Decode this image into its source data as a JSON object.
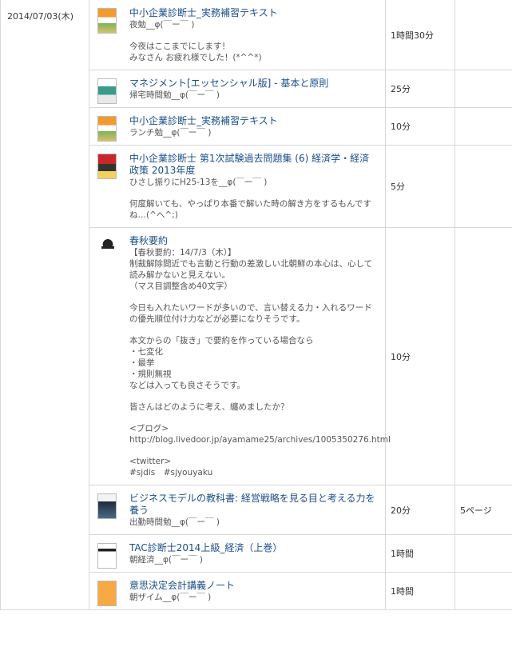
{
  "date": "2014/07/03(木)",
  "entries": [
    {
      "title": "中小企業診断士_実務補習テキスト",
      "subtitle": "夜勉__φ(￣ー￣ )",
      "comments": [
        "今夜はここまでにします！\nみなさん お疲れ様でした！(*^^*)"
      ],
      "time": "1時間30分",
      "pages": "",
      "thumb": "orange"
    },
    {
      "title": "マネジメント[エッセンシャル版] - 基本と原則",
      "subtitle": "帰宅時間勉__φ(￣ー￣ )",
      "comments": [],
      "time": "25分",
      "pages": "",
      "thumb": "teal"
    },
    {
      "title": "中小企業診断士_実務補習テキスト",
      "subtitle": "ランチ勉__φ(￣ー￣ )",
      "comments": [],
      "time": "10分",
      "pages": "",
      "thumb": "orange"
    },
    {
      "title": "中小企業診断士 第1次試験過去問題集 (6) 経済学・経済政策 2013年度",
      "subtitle": "ひさし振りにH25-13を__φ(￣ー￣ )",
      "comments": [
        "何度解いても、やっぱり本番で解いた時の解き方をするもんですね…(^へ^;)"
      ],
      "time": "5分",
      "pages": "",
      "thumb": "red"
    },
    {
      "title": "春秋要約",
      "subtitle": "【春秋要約：14/7/3（木）】",
      "comments": [
        "制裁解除間近でも言動と行動の差激しい北朝鮮の本心は、心して読み解かないと見えない。\n（マス目調整含め40文字）",
        "今日も入れたいワードが多いので、言い替える力・入れるワードの優先順位付け力などが必要になりそうです。",
        "本文からの「抜き」で要約を作っている場合なら\n・七変化\n・最挙\n・規則無視\nなどは入っても良さそうです。",
        "皆さんはどのように考え、纏めましたか？",
        "<ブログ>\nhttp://blog.livedoor.jp/ayamame25/archives/1005350276.html",
        "<twitter>\n#sjdis　#sjyouyaku"
      ],
      "time": "10分",
      "pages": "",
      "thumb": "logo"
    },
    {
      "title": "ビジネスモデルの教科書: 経営戦略を見る目と考える力を養う",
      "subtitle": "出勤時間勉__φ(￣ー￣ )",
      "comments": [],
      "time": "20分",
      "pages": "5ページ",
      "thumb": "dark"
    },
    {
      "title": "TAC診断士2014上級_経済（上巻）",
      "subtitle": "朝経済__φ(￣ー￣ )",
      "comments": [],
      "time": "1時間",
      "pages": "",
      "thumb": "white"
    },
    {
      "title": "意思決定会計講義ノート",
      "subtitle": "朝ザイム__φ(￣ー￣ )",
      "comments": [],
      "time": "1時間",
      "pages": "",
      "thumb": "orange2"
    }
  ],
  "colors": {
    "link": "#1a4e8a",
    "border": "#d8d8d8",
    "text": "#333333"
  }
}
